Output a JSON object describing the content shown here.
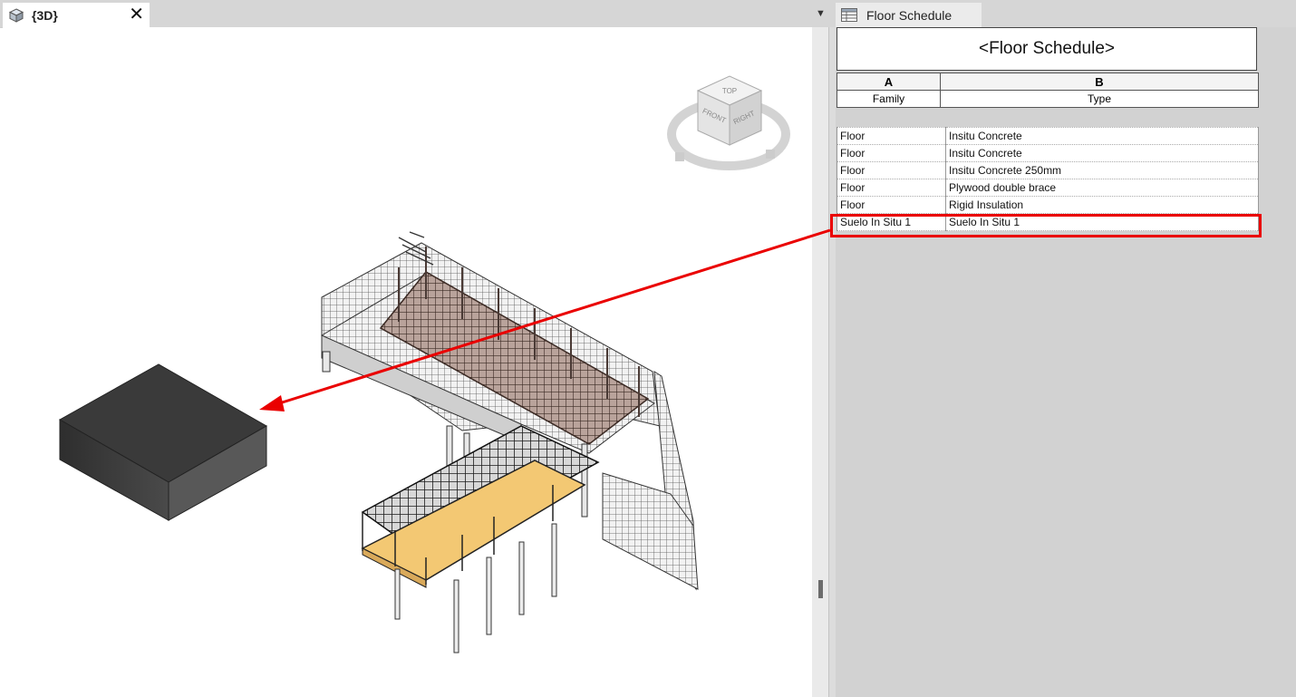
{
  "tabs": {
    "view3d": {
      "label": "{3D}",
      "close": "✕"
    },
    "schedule": {
      "label": "Floor Schedule"
    }
  },
  "viewcube": {
    "top": "TOP",
    "front": "FRONT",
    "right": "RIGHT"
  },
  "schedule": {
    "title": "<Floor Schedule>",
    "column_letters": [
      "A",
      "B"
    ],
    "column_headers": [
      "Family",
      "Type"
    ],
    "rows": [
      {
        "family": "Floor",
        "type": "Insitu Concrete"
      },
      {
        "family": "Floor",
        "type": "Insitu Concrete"
      },
      {
        "family": "Floor",
        "type": "Insitu Concrete 250mm"
      },
      {
        "family": "Floor",
        "type": "Plywood double brace"
      },
      {
        "family": "Floor",
        "type": "Rigid Insulation"
      },
      {
        "family": "Suelo In Situ 1",
        "type": "Suelo In Situ 1"
      }
    ]
  },
  "colors": {
    "highlight": "#ea0000",
    "deck": "#f3c873",
    "box": "#3a3a3a"
  }
}
